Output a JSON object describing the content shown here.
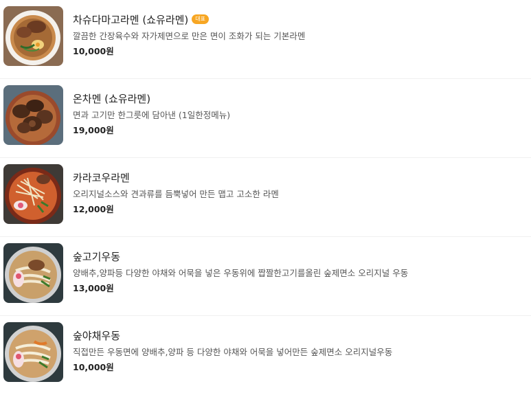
{
  "menu": {
    "items": [
      {
        "name": "차슈다마고라멘 (쇼유라멘)",
        "badge": "대표",
        "description": "깔끔한 간장육수와 자가제면으로 만은 면이 조화가 되는 기본라멘",
        "price": "10,000원",
        "image_icon": "ramen-photo"
      },
      {
        "name": "온차멘 (쇼유라멘)",
        "badge": "",
        "description": "면과 고기만 한그릇에 담아낸 (1일한정메뉴)",
        "price": "19,000원",
        "image_icon": "chashu-ramen-photo"
      },
      {
        "name": "카라코우라멘",
        "badge": "",
        "description": "오리지널소스와 견과류를 듬뿍넣어 만든 맵고 고소한 라멘",
        "price": "12,000원",
        "image_icon": "spicy-ramen-photo"
      },
      {
        "name": "숲고기우동",
        "badge": "",
        "description": "양배추,양파등 다양한 야채와 어묵을 넣은 우동위에 짭짤한고기를올린 숲제면소 오리지널 우동",
        "price": "13,000원",
        "image_icon": "meat-udon-photo"
      },
      {
        "name": "숲야채우동",
        "badge": "",
        "description": "직접만든 우동면에 양배추,양파 등 다양한 야채와 어묵을 넣어만든 숲제면소 오리지널우동",
        "price": "10,000원",
        "image_icon": "vegetable-udon-photo"
      }
    ]
  },
  "colors": {
    "badge": "#f7a623",
    "divider": "#efefef",
    "text": "#222222",
    "desc": "#555555"
  }
}
